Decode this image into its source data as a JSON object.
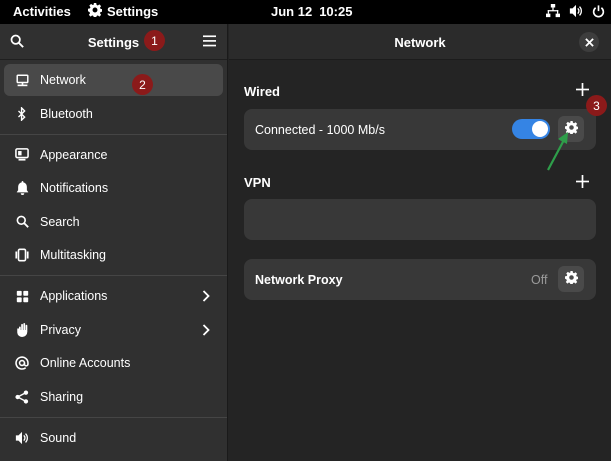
{
  "topbar": {
    "activities": "Activities",
    "app_name": "Settings",
    "date": "Jun 12",
    "time": "10:25"
  },
  "sidebar": {
    "title": "Settings",
    "groups": [
      [
        {
          "label": "Network",
          "icon": "network-wired-icon",
          "active": true
        },
        {
          "label": "Bluetooth",
          "icon": "bluetooth-icon"
        }
      ],
      [
        {
          "label": "Appearance",
          "icon": "appearance-icon"
        },
        {
          "label": "Notifications",
          "icon": "bell-icon"
        },
        {
          "label": "Search",
          "icon": "search-icon"
        },
        {
          "label": "Multitasking",
          "icon": "multitasking-icon"
        }
      ],
      [
        {
          "label": "Applications",
          "icon": "applications-icon",
          "chevron": true
        },
        {
          "label": "Privacy",
          "icon": "privacy-hand-icon",
          "chevron": true
        },
        {
          "label": "Online Accounts",
          "icon": "at-sign-icon"
        },
        {
          "label": "Sharing",
          "icon": "share-icon"
        }
      ],
      [
        {
          "label": "Sound",
          "icon": "speaker-icon"
        }
      ]
    ]
  },
  "main": {
    "title": "Network",
    "wired": {
      "heading": "Wired",
      "status": "Connected - 1000 Mb/s",
      "enabled": true
    },
    "vpn": {
      "heading": "VPN"
    },
    "proxy": {
      "label": "Network Proxy",
      "state": "Off"
    }
  },
  "annotations": {
    "badge1": "1",
    "badge2": "2",
    "badge3": "3"
  },
  "colors": {
    "accent": "#3584e4",
    "badge": "#8b1a1a",
    "arrow": "#2e9e4a"
  }
}
